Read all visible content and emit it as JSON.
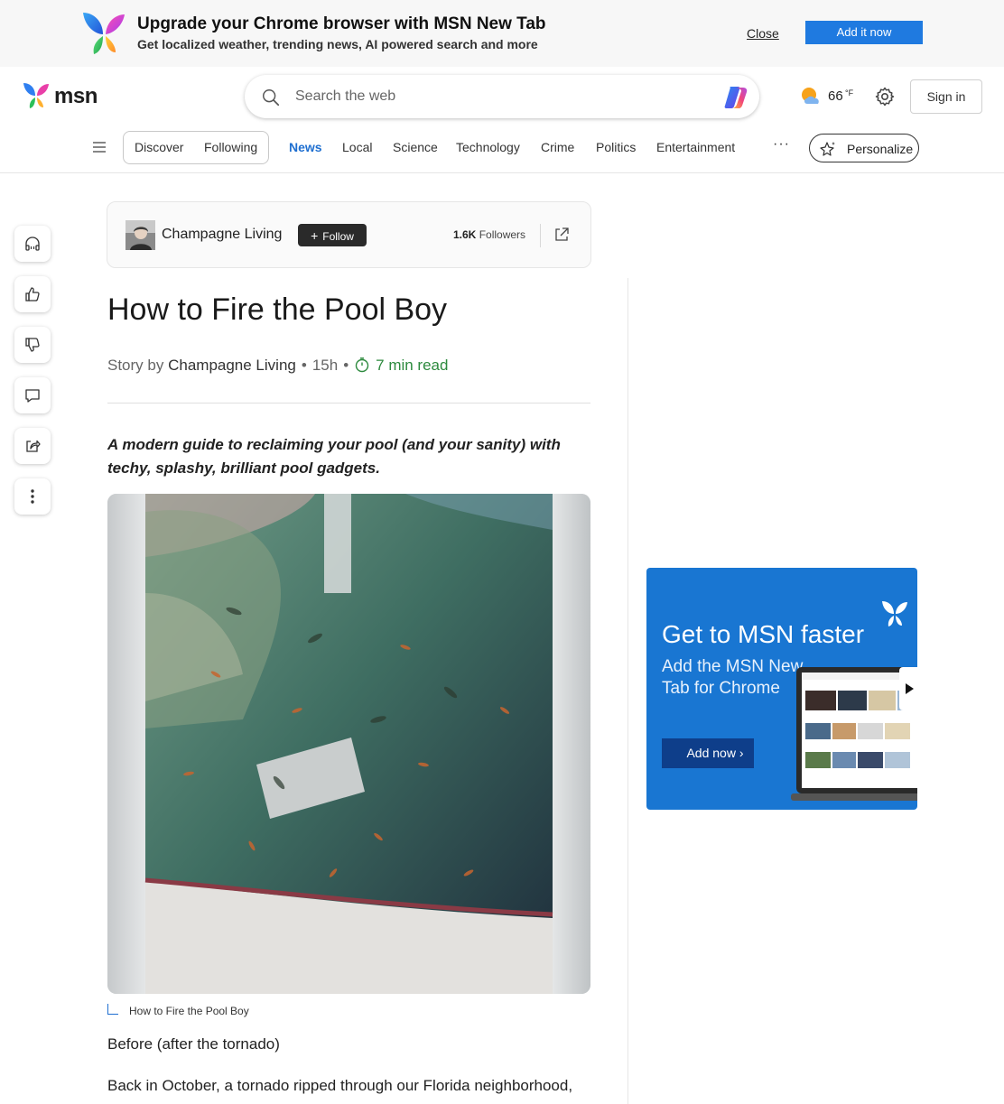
{
  "promo": {
    "title": "Upgrade your Chrome browser with MSN New Tab",
    "subtitle": "Get localized weather, trending news, AI powered search and more",
    "close_label": "Close",
    "add_label": "Add it now"
  },
  "header": {
    "logo_text": "msn",
    "search_placeholder": "Search the web",
    "weather_temp": "66",
    "weather_unit": "°F",
    "signin_label": "Sign in"
  },
  "nav": {
    "segments": [
      "Discover",
      "Following"
    ],
    "items": [
      "News",
      "Local",
      "Science",
      "Technology",
      "Crime",
      "Politics",
      "Entertainment"
    ],
    "active_item": "News",
    "more_label": "···",
    "personalize_label": "Personalize"
  },
  "publisher": {
    "name": "Champagne Living",
    "follow_label": "Follow",
    "followers_count": "1.6K",
    "followers_label": "Followers"
  },
  "article": {
    "title": "How to Fire the Pool Boy",
    "byline_prefix": "Story by",
    "author": "Champagne Living",
    "age": "15h",
    "read_time": "7 min read",
    "lede": "A modern guide to reclaiming your pool (and your sanity) with techy, splashy, brilliant pool gadgets.",
    "image_caption": "How to Fire the Pool Boy",
    "paragraph_1": "Before (after the tornado)",
    "paragraph_2": "Back in October, a tornado ripped through our Florida neighborhood,"
  },
  "ad": {
    "title": "Get to MSN faster",
    "subtitle": "Add the MSN New Tab for Chrome",
    "button_label": "Add now"
  },
  "colors": {
    "accent": "#1f6fd0",
    "promo_button": "#1f7ae0",
    "ad_background": "#1976d2",
    "read_time": "#2d8a3e"
  }
}
